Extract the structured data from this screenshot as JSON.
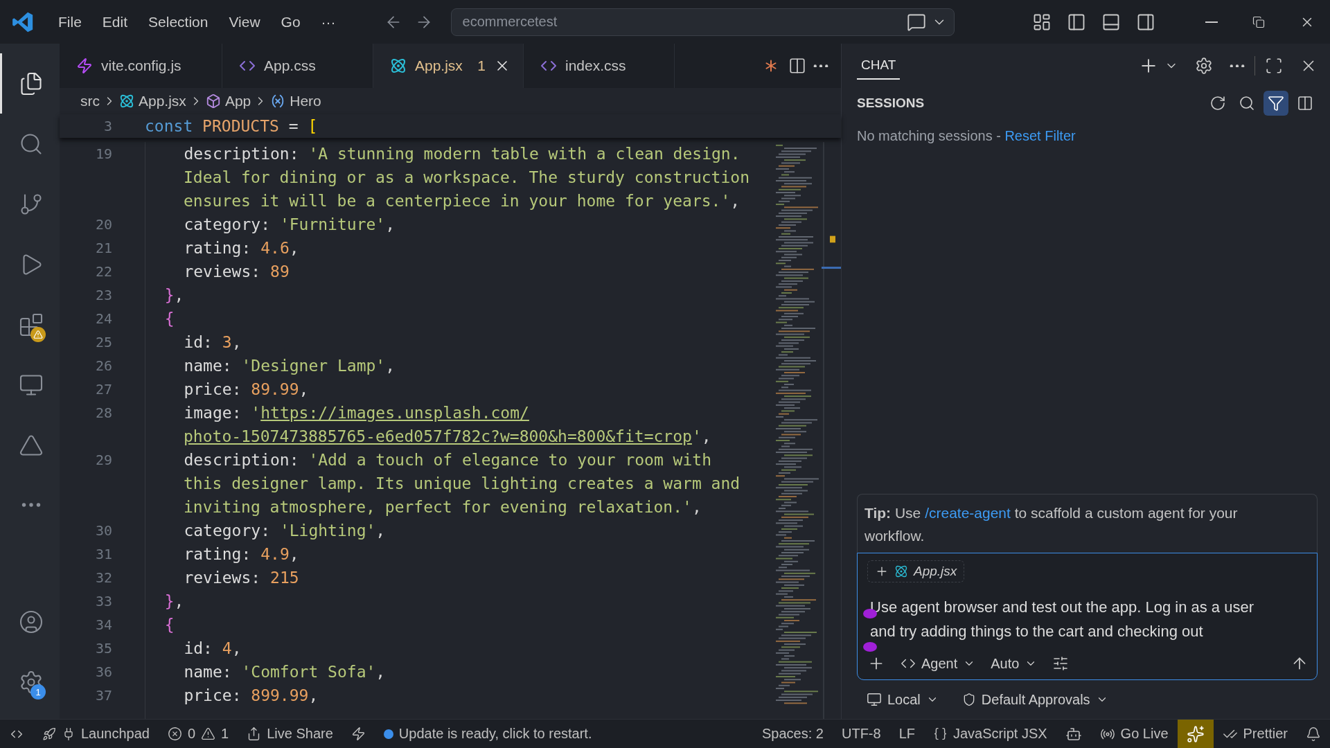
{
  "menu": [
    "File",
    "Edit",
    "Selection",
    "View",
    "Go",
    "···"
  ],
  "command_center": {
    "value": "ecommercetest"
  },
  "activity_bar": {
    "top": [
      {
        "kind": "explorer",
        "selected": true,
        "warning": false
      },
      {
        "kind": "search",
        "selected": false,
        "warning": false
      },
      {
        "kind": "source-control",
        "selected": false,
        "warning": false
      },
      {
        "kind": "run-debug",
        "selected": false,
        "warning": false
      },
      {
        "kind": "extensions",
        "selected": false,
        "warning": true
      },
      {
        "kind": "remote",
        "selected": false,
        "warning": false
      },
      {
        "kind": "triangle",
        "selected": false,
        "warning": false
      },
      {
        "kind": "more",
        "selected": false,
        "warning": false
      }
    ],
    "bottom": [
      {
        "kind": "account"
      },
      {
        "kind": "settings",
        "badge": "1"
      }
    ]
  },
  "tabs": [
    {
      "label": "vite.config.js",
      "kind": "vite",
      "selected": false
    },
    {
      "label": "App.css",
      "kind": "css",
      "selected": false
    },
    {
      "label": "App.jsx",
      "kind": "react",
      "selected": true,
      "problems": "1"
    },
    {
      "label": "index.css",
      "kind": "css",
      "selected": false
    }
  ],
  "breadcrumbs": [
    {
      "label": "src",
      "kind": "folder"
    },
    {
      "label": "App.jsx",
      "kind": "react"
    },
    {
      "label": "App",
      "kind": "component"
    },
    {
      "label": "Hero",
      "kind": "variable"
    }
  ],
  "editor": {
    "sticky": {
      "number": "3",
      "rows": [
        {
          "tokens": [
            {
              "kind": "kw",
              "text": "const "
            },
            {
              "kind": "name",
              "text": "PRODUCTS"
            },
            {
              "kind": "p",
              "text": " = "
            },
            {
              "kind": "br1",
              "text": "["
            }
          ]
        }
      ]
    },
    "lines": [
      {
        "number": "19",
        "rows": [
          {
            "tokens": [
              {
                "kind": "prop",
                "text": "    description"
              },
              {
                "kind": "p",
                "text": ": "
              },
              {
                "kind": "str",
                "text": "'A stunning modern table with a clean design."
              }
            ]
          },
          {
            "tokens": [
              {
                "kind": "str",
                "text": "Ideal for dining or as a workspace. The sturdy construction"
              }
            ]
          },
          {
            "tokens": [
              {
                "kind": "str",
                "text": "ensures it will be a centerpiece in your home for years.'"
              },
              {
                "kind": "p",
                "text": ","
              }
            ]
          }
        ]
      },
      {
        "number": "20",
        "rows": [
          {
            "tokens": [
              {
                "kind": "prop",
                "text": "    category"
              },
              {
                "kind": "p",
                "text": ": "
              },
              {
                "kind": "str",
                "text": "'Furniture'"
              },
              {
                "kind": "p",
                "text": ","
              }
            ]
          }
        ]
      },
      {
        "number": "21",
        "rows": [
          {
            "tokens": [
              {
                "kind": "prop",
                "text": "    rating"
              },
              {
                "kind": "p",
                "text": ": "
              },
              {
                "kind": "num",
                "text": "4.6"
              },
              {
                "kind": "p",
                "text": ","
              }
            ]
          }
        ]
      },
      {
        "number": "22",
        "rows": [
          {
            "tokens": [
              {
                "kind": "prop",
                "text": "    reviews"
              },
              {
                "kind": "p",
                "text": ": "
              },
              {
                "kind": "num",
                "text": "89"
              }
            ]
          }
        ]
      },
      {
        "number": "23",
        "rows": [
          {
            "tokens": [
              {
                "kind": "br2",
                "text": "  }"
              },
              {
                "kind": "p",
                "text": ","
              }
            ]
          }
        ]
      },
      {
        "number": "24",
        "rows": [
          {
            "tokens": [
              {
                "kind": "br2",
                "text": "  {"
              }
            ]
          }
        ]
      },
      {
        "number": "25",
        "rows": [
          {
            "tokens": [
              {
                "kind": "prop",
                "text": "    id"
              },
              {
                "kind": "p",
                "text": ": "
              },
              {
                "kind": "num",
                "text": "3"
              },
              {
                "kind": "p",
                "text": ","
              }
            ]
          }
        ]
      },
      {
        "number": "26",
        "rows": [
          {
            "tokens": [
              {
                "kind": "prop",
                "text": "    name"
              },
              {
                "kind": "p",
                "text": ": "
              },
              {
                "kind": "str",
                "text": "'Designer Lamp'"
              },
              {
                "kind": "p",
                "text": ","
              }
            ]
          }
        ]
      },
      {
        "number": "27",
        "rows": [
          {
            "tokens": [
              {
                "kind": "prop",
                "text": "    price"
              },
              {
                "kind": "p",
                "text": ": "
              },
              {
                "kind": "num",
                "text": "89.99"
              },
              {
                "kind": "p",
                "text": ","
              }
            ]
          }
        ]
      },
      {
        "number": "28",
        "rows": [
          {
            "tokens": [
              {
                "kind": "prop",
                "text": "    image"
              },
              {
                "kind": "p",
                "text": ": "
              },
              {
                "kind": "str",
                "text": "'"
              },
              {
                "kind": "link",
                "text": "https://images.unsplash.com/"
              }
            ]
          },
          {
            "tokens": [
              {
                "kind": "link",
                "text": "photo-1507473885765-e6ed057f782c?w=800&h=800&fit=crop"
              },
              {
                "kind": "str",
                "text": "'"
              },
              {
                "kind": "p",
                "text": ","
              }
            ]
          }
        ]
      },
      {
        "number": "29",
        "rows": [
          {
            "tokens": [
              {
                "kind": "prop",
                "text": "    description"
              },
              {
                "kind": "p",
                "text": ": "
              },
              {
                "kind": "str",
                "text": "'Add a touch of elegance to your room with"
              }
            ]
          },
          {
            "tokens": [
              {
                "kind": "str",
                "text": "this designer lamp. Its unique lighting creates a warm and"
              }
            ]
          },
          {
            "tokens": [
              {
                "kind": "str",
                "text": "inviting atmosphere, perfect for evening relaxation.'"
              },
              {
                "kind": "p",
                "text": ","
              }
            ]
          }
        ]
      },
      {
        "number": "30",
        "rows": [
          {
            "tokens": [
              {
                "kind": "prop",
                "text": "    category"
              },
              {
                "kind": "p",
                "text": ": "
              },
              {
                "kind": "str",
                "text": "'Lighting'"
              },
              {
                "kind": "p",
                "text": ","
              }
            ]
          }
        ]
      },
      {
        "number": "31",
        "rows": [
          {
            "tokens": [
              {
                "kind": "prop",
                "text": "    rating"
              },
              {
                "kind": "p",
                "text": ": "
              },
              {
                "kind": "num",
                "text": "4.9"
              },
              {
                "kind": "p",
                "text": ","
              }
            ]
          }
        ]
      },
      {
        "number": "32",
        "rows": [
          {
            "tokens": [
              {
                "kind": "prop",
                "text": "    reviews"
              },
              {
                "kind": "p",
                "text": ": "
              },
              {
                "kind": "num",
                "text": "215"
              }
            ]
          }
        ]
      },
      {
        "number": "33",
        "rows": [
          {
            "tokens": [
              {
                "kind": "br2",
                "text": "  }"
              },
              {
                "kind": "p",
                "text": ","
              }
            ]
          }
        ]
      },
      {
        "number": "34",
        "rows": [
          {
            "tokens": [
              {
                "kind": "br2",
                "text": "  {"
              }
            ]
          }
        ]
      },
      {
        "number": "35",
        "rows": [
          {
            "tokens": [
              {
                "kind": "prop",
                "text": "    id"
              },
              {
                "kind": "p",
                "text": ": "
              },
              {
                "kind": "num",
                "text": "4"
              },
              {
                "kind": "p",
                "text": ","
              }
            ]
          }
        ]
      },
      {
        "number": "36",
        "rows": [
          {
            "tokens": [
              {
                "kind": "prop",
                "text": "    name"
              },
              {
                "kind": "p",
                "text": ": "
              },
              {
                "kind": "str",
                "text": "'Comfort Sofa'"
              },
              {
                "kind": "p",
                "text": ","
              }
            ]
          }
        ]
      },
      {
        "number": "37",
        "rows": [
          {
            "tokens": [
              {
                "kind": "prop",
                "text": "    price"
              },
              {
                "kind": "p",
                "text": ": "
              },
              {
                "kind": "num",
                "text": "899.99"
              },
              {
                "kind": "p",
                "text": ","
              }
            ]
          }
        ]
      }
    ]
  },
  "chat": {
    "tabs": [
      {
        "label": "CHAT",
        "selected": true
      }
    ],
    "sessions_title": "SESSIONS",
    "filter_active": true,
    "empty_text": "No matching sessions - ",
    "reset_link": "Reset Filter",
    "tip": {
      "label": "Tip:",
      "before": " Use ",
      "command": "/create-agent",
      "after": " to scaffold a custom agent for your workflow."
    },
    "context_file": "App.jsx",
    "input_value": "Use agent browser and test out the app. Log in as a user and try adding things to the cart and checking out",
    "mode": "Agent",
    "model": "Auto",
    "location": "Local",
    "approvals": "Default Approvals"
  },
  "status_left": [
    {
      "kind": "remote"
    },
    {
      "kind": "launchpad",
      "label": "Launchpad"
    },
    {
      "kind": "problems",
      "errors": "0",
      "warnings": "1"
    },
    {
      "kind": "live-share",
      "label": "Live Share"
    },
    {
      "kind": "lightning"
    },
    {
      "kind": "update",
      "label": "Update is ready, click to restart."
    }
  ],
  "status_right": [
    {
      "kind": "text",
      "label": "Spaces: 2"
    },
    {
      "kind": "text",
      "label": "UTF-8"
    },
    {
      "kind": "text",
      "label": "LF"
    },
    {
      "kind": "language",
      "label": "JavaScript JSX"
    },
    {
      "kind": "copilot"
    },
    {
      "kind": "go-live",
      "label": "Go Live"
    },
    {
      "kind": "highlighted-tool"
    },
    {
      "kind": "prettier",
      "label": "Prettier"
    },
    {
      "kind": "bell"
    }
  ]
}
